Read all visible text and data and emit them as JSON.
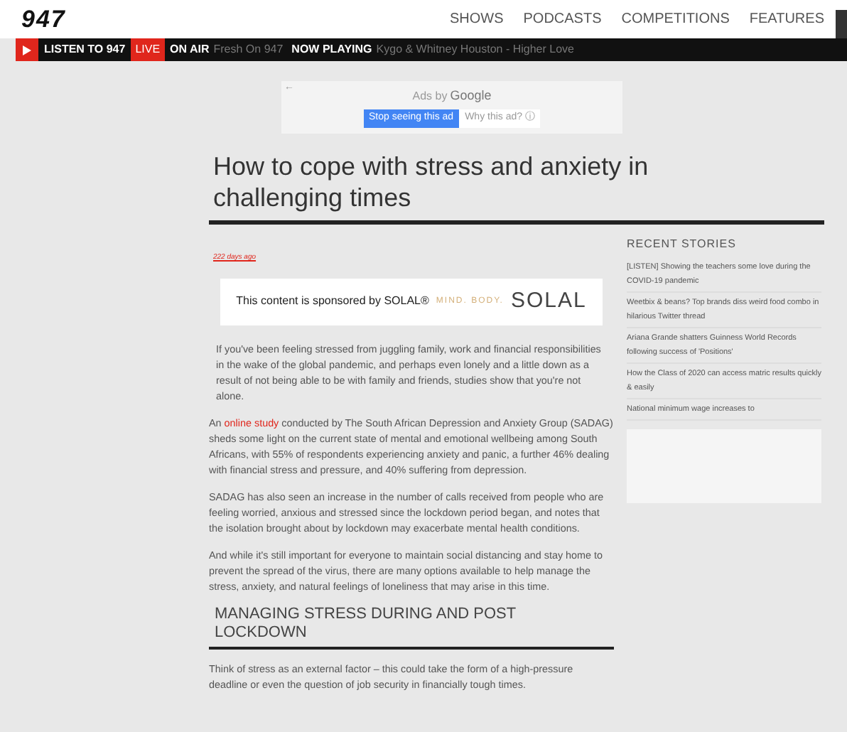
{
  "header": {
    "logo": "947",
    "nav": [
      {
        "label": "SHOWS"
      },
      {
        "label": "PODCASTS"
      },
      {
        "label": "COMPETITIONS"
      },
      {
        "label": "FEATURES"
      }
    ]
  },
  "ticker": {
    "listen": "LISTEN TO 947",
    "live": "LIVE",
    "on_air_label": "ON AIR",
    "on_air": "Fresh On 947",
    "now_playing_label": "NOW PLAYING",
    "now_playing": "Kygo & Whitney Houston - Higher Love"
  },
  "ad": {
    "back": "←",
    "title": "Ads by",
    "brand": "Google",
    "stop_button": "Stop seeing this ad",
    "why_button": "Why this ad?",
    "info": "ⓘ"
  },
  "article": {
    "title": "How to cope with stress and anxiety in challenging times",
    "date": "222 days ago",
    "sponsor": {
      "text": "This content is sponsored by SOLAL®",
      "tagline": "MIND. BODY.",
      "logo": "SOLAL"
    },
    "paragraphs": [
      {
        "after": "If you've been feeling stressed from juggling family, work and financial responsibilities in the wake of the global pandemic, and perhaps even lonely and a little down as a result of not being able to be with family and friends, studies show that you're not alone."
      },
      {
        "before": "An ",
        "link": "online study",
        "after": " conducted by The South African Depression and Anxiety Group (SADAG) sheds some light on the current state of mental and emotional wellbeing among South Africans, with 55% of respondents experiencing anxiety and panic, a further 46% dealing with financial stress and pressure, and 40% suffering from depression."
      },
      {
        "after": "SADAG has also seen an increase in the number of calls received from people who are feeling worried, anxious and stressed since the lockdown period began, and notes that the isolation brought about by lockdown may exacerbate mental health conditions."
      },
      {
        "after": "And while it's still important for everyone to maintain social distancing and stay home to prevent the spread of the virus, there are many options available to help manage the stress, anxiety, and natural feelings of loneliness that may arise in this time."
      }
    ],
    "subheading": "MANAGING STRESS DURING AND POST LOCKDOWN",
    "last_paragraph": "Think of stress as an external factor – this could take the form of a high-pressure deadline or even the question of job security in financially tough times."
  },
  "sidebar": {
    "title": "RECENT STORIES",
    "stories": [
      "[LISTEN] Showing the teachers some love during the COVID-19 pandemic",
      "Weetbix & beans? Top brands diss weird food combo in hilarious Twitter thread",
      "Ariana Grande shatters Guinness World Records following success of 'Positions'",
      "How the Class of 2020 can access matric results quickly & easily",
      "National minimum wage increases to"
    ]
  }
}
